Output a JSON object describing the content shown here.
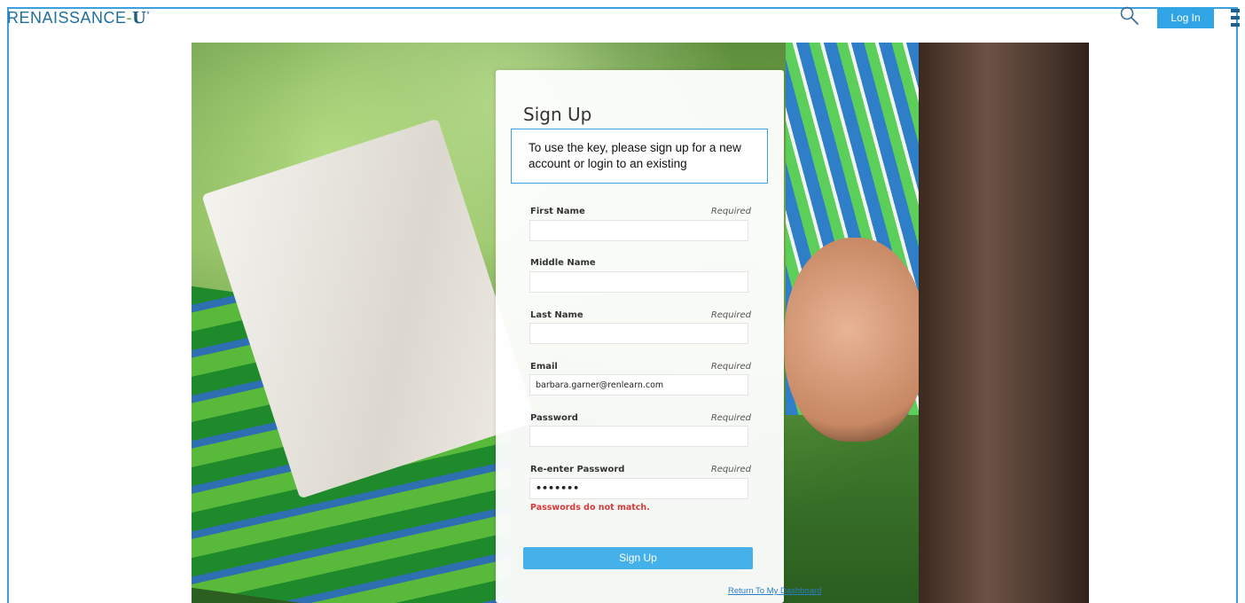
{
  "header": {
    "logo": {
      "part1": "RENAISSANCE",
      "dash": "-",
      "u": "U",
      "mark": "*"
    },
    "login_label": "Log In",
    "icons": {
      "search": "search-icon",
      "menu": "hamburger-menu-icon"
    },
    "colors": {
      "accent": "#31a4e6",
      "frame": "#3aa0e0"
    }
  },
  "form": {
    "title": "Sign Up",
    "note": "To use the key, please sign up for a new account or login to an existing",
    "required_label": "Required",
    "fields": [
      {
        "label": "First Name",
        "required": true,
        "value": ""
      },
      {
        "label": "Middle Name",
        "required": false,
        "value": ""
      },
      {
        "label": "Last Name",
        "required": true,
        "value": ""
      },
      {
        "label": "Email",
        "required": true,
        "value": "barbara.garner@renlearn.com"
      },
      {
        "label": "Password",
        "required": true,
        "value": ""
      },
      {
        "label": "Re-enter Password",
        "required": true,
        "value": "•••••••"
      }
    ],
    "error": "Passwords do not match.",
    "submit_label": "Sign Up",
    "return_link": "Return To My Dashboard",
    "colors": {
      "error": "#d63a3a",
      "button": "#45b1ea"
    }
  }
}
